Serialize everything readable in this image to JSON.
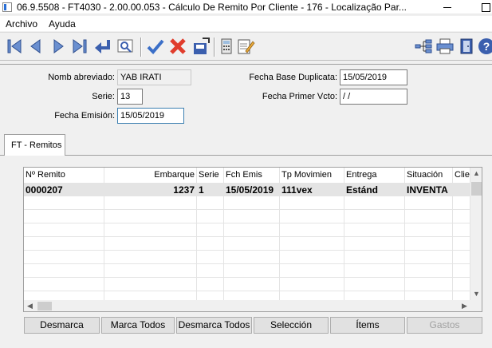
{
  "window": {
    "title": "06.9.5508 - FT4030 - 2.00.00.053 - Cálculo De Remito Por Cliente - 176 - Localização Par..."
  },
  "menu": {
    "items": [
      "Archivo",
      "Ayuda"
    ]
  },
  "toolbar": {
    "left_icons": [
      "first-record-icon",
      "previous-record-icon",
      "next-record-icon",
      "last-record-icon",
      "return-icon",
      "preview-icon",
      "confirm-icon",
      "cancel-icon",
      "save-icon",
      "calculator-icon",
      "notepad-icon"
    ],
    "right_icons": [
      "tree-icon",
      "print-icon",
      "exit-icon",
      "help-icon"
    ]
  },
  "form": {
    "nomb_abreviado": {
      "label": "Nomb abreviado:",
      "value": "YAB IRATI"
    },
    "serie": {
      "label": "Serie:",
      "value": "13"
    },
    "fecha_emision": {
      "label": "Fecha Emisión:",
      "value": "15/05/2019"
    },
    "fecha_base_duplicata": {
      "label": "Fecha Base Duplicata:",
      "value": "15/05/2019"
    },
    "fecha_primer_vcto": {
      "label": "Fecha Primer Vcto:",
      "value": " / /"
    }
  },
  "tab": {
    "label": "FT - Remitos"
  },
  "grid": {
    "columns": [
      "Nº Remito",
      "Embarque",
      "Serie",
      "Fch Emis",
      "Tp Movimien",
      "Entrega",
      "Situación",
      "Clier"
    ],
    "rows": [
      [
        "0000207",
        "1237",
        "1",
        "15/05/2019",
        "111vex",
        "Estánd",
        "INVENTA",
        ""
      ]
    ]
  },
  "buttons": {
    "desmarca": "Desmarca",
    "marca_todos": "Marca Todos",
    "desmarca_todos": "Desmarca Todos",
    "seleccion": "Selección",
    "items": "Ítems",
    "gastos": "Gastos"
  },
  "colors": {
    "accent_blue": "#3b5fae",
    "confirm_check": "#3b6fc8",
    "cancel_x": "#e03c2c"
  }
}
